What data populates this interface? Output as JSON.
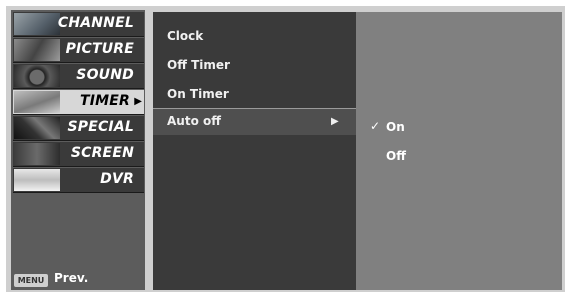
{
  "sidebar": {
    "items": [
      {
        "label": "CHANNEL",
        "icon": "channel-thumbnail",
        "selected": false
      },
      {
        "label": "PICTURE",
        "icon": "picture-thumbnail",
        "selected": false
      },
      {
        "label": "SOUND",
        "icon": "sound-thumbnail",
        "selected": false
      },
      {
        "label": "TIMER",
        "icon": "timer-thumbnail",
        "selected": true
      },
      {
        "label": "SPECIAL",
        "icon": "special-thumbnail",
        "selected": false
      },
      {
        "label": "SCREEN",
        "icon": "screen-thumbnail",
        "selected": false
      },
      {
        "label": "DVR",
        "icon": "dvr-thumbnail",
        "selected": false
      }
    ],
    "footer": {
      "key_label": "MENU",
      "prev_label": "Prev."
    }
  },
  "submenu": {
    "items": [
      {
        "label": "Clock"
      },
      {
        "label": "Off Timer"
      },
      {
        "label": "On Timer"
      },
      {
        "label": "Auto off",
        "active": true
      }
    ],
    "arrow_icon": "right-triangle-icon"
  },
  "options": {
    "items": [
      {
        "label": "On",
        "checked": true
      },
      {
        "label": "Off",
        "checked": false
      }
    ],
    "check_icon": "checkmark-icon"
  },
  "colors": {
    "sidebar_bg": "#5c5c5c",
    "menu_item_bg": "#3a3a3a",
    "menu_item_selected_bg": "#d7d7d7",
    "submenu_bg": "#3a3a3a",
    "options_bg": "#808080"
  }
}
